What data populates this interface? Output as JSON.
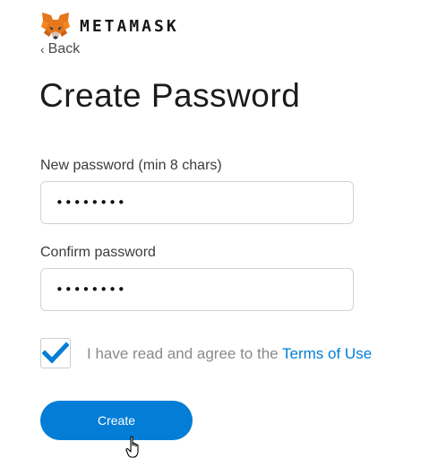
{
  "brand": {
    "name": "METAMASK",
    "logo_icon": "metamask-fox-icon"
  },
  "nav": {
    "back_label": "Back",
    "back_icon": "chevron-left-icon"
  },
  "page": {
    "title": "Create Password"
  },
  "form": {
    "new_password": {
      "label": "New password (min 8 chars)",
      "value": "••••••••"
    },
    "confirm_password": {
      "label": "Confirm password",
      "value": "••••••••"
    },
    "agreement": {
      "checked": true,
      "text": "I have read and agree to the",
      "link_label": "Terms of Use"
    },
    "submit_label": "Create"
  },
  "colors": {
    "accent": "#037dd6",
    "text": "#24292e",
    "muted": "#8a8a8a",
    "border": "#cfd3d8"
  }
}
